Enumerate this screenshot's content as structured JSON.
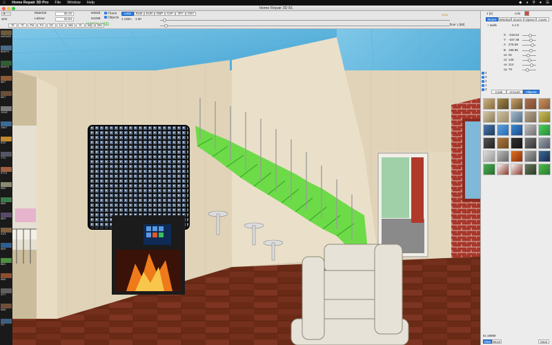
{
  "menubar": {
    "app": "Home Repair 3D Pro",
    "items": [
      "File",
      "Window",
      "Help"
    ]
  },
  "window": {
    "title": "Home Repair 3D 81"
  },
  "toolbar": {
    "project_name": "w03",
    "material_label": "Material",
    "material_value": "36.23",
    "material_total": "84633",
    "labour_label": "Labour",
    "labour_value": "22.94",
    "labour_total": "54298",
    "floors_label": "Floors",
    "objects_label": "Objects",
    "currencies": [
      "USD",
      "RUB",
      "EUR",
      "GBP",
      "CHF",
      "JPY",
      "CNY"
    ],
    "active_currency": "USD",
    "rate_label": "1 USD=",
    "rate_value": "1.00",
    "total": "118831 USD",
    "mode_buttons": [
      "Fl",
      "Tl",
      "Pa",
      "Fv",
      "Gr",
      "La",
      "Ma",
      "G",
      "Wp",
      "Wn"
    ],
    "floor_label": "floor 1 [50]",
    "price_tag": "£112"
  },
  "left_thumbs": [
    {
      "label": "w02/w03",
      "color": "#6a5a3c"
    },
    {
      "label": "504/F5",
      "color": "#4b6a8a"
    },
    {
      "label": "504/F5",
      "color": "#2e5f34"
    },
    {
      "label": "58/7",
      "color": "#8e5a36"
    },
    {
      "label": "58/7",
      "color": "#6b4f3a"
    },
    {
      "label": "141/8",
      "color": "#7a7a7a"
    },
    {
      "label": "156/7",
      "color": "#3a6a95"
    },
    {
      "label": "61/0",
      "color": "#c08a30"
    },
    {
      "label": "77/1",
      "color": "#556"
    },
    {
      "label": "077/1",
      "color": "#a06040"
    },
    {
      "label": "58/0",
      "color": "#8a8a70"
    },
    {
      "label": "58/0",
      "color": "#3b7a4a"
    },
    {
      "label": "58/3",
      "color": "#5a4a6a"
    },
    {
      "label": "41/3",
      "color": "#806040"
    },
    {
      "label": "99/9",
      "color": "#2f5f8f"
    },
    {
      "label": "68/1",
      "color": "#4c8f3f"
    },
    {
      "label": "56/6",
      "color": "#8f4f2f"
    },
    {
      "label": "22/7",
      "color": "#606060"
    },
    {
      "label": "58/8",
      "color": "#704f3a"
    },
    {
      "label": "7/7",
      "color": "#3f5f7f"
    }
  ],
  "right_panel": {
    "counter": "1 [4]",
    "color_label": "colo",
    "tabs_top": [
      "Room",
      "Window",
      "Doors",
      "Opens",
      "Cover"
    ],
    "active_top": "Room",
    "walls_label": "+ walls",
    "walls_value": "4 x 8",
    "props": [
      {
        "name": "X",
        "value": "-216.54",
        "level": 0.55
      },
      {
        "name": "Y",
        "value": "-157.48",
        "level": 0.6
      },
      {
        "name": "A",
        "value": "275.59",
        "level": 0.7
      },
      {
        "name": "B",
        "value": "196.85",
        "level": 0.62
      },
      {
        "name": "ox",
        "value": "61",
        "level": 0.4
      },
      {
        "name": "oz",
        "value": "125",
        "level": 0.5
      },
      {
        "name": "ox",
        "value": "214",
        "level": 0.66
      },
      {
        "name": "oy",
        "value": "70",
        "level": 0.35
      }
    ],
    "levels": [
      "4",
      "3",
      "2",
      "1",
      "0"
    ],
    "tabs_mid": [
      "Code",
      "Amount",
      "Objects"
    ],
    "active_mid": "Objects",
    "objects": [
      {
        "name": "glasses-object-icon",
        "c1": "#c7b58a",
        "c2": "#8a6a3a"
      },
      {
        "name": "chair-object-icon",
        "c1": "#a88a4a",
        "c2": "#5a4a2a"
      },
      {
        "name": "building-object-icon",
        "c1": "#c9a36a",
        "c2": "#6a5030"
      },
      {
        "name": "rug-object-icon",
        "c1": "#b07050",
        "c2": "#7a4a30"
      },
      {
        "name": "sofa-object-icon",
        "c1": "#c8945a",
        "c2": "#8a5a3a"
      },
      {
        "name": "shelf-object-icon",
        "c1": "#d5c9a5",
        "c2": "#8a7a55"
      },
      {
        "name": "pillow-object-icon",
        "c1": "#cfc2a0",
        "c2": "#9a8a6a"
      },
      {
        "name": "cabinet-object-icon",
        "c1": "#a5b9c9",
        "c2": "#50708a"
      },
      {
        "name": "pillow-two-object-icon",
        "c1": "#b8a890",
        "c2": "#7a6a55"
      },
      {
        "name": "lamp-object-icon",
        "c1": "#c9c05a",
        "c2": "#8a7a2a"
      },
      {
        "name": "tv-object-icon",
        "c1": "#4a7ab0",
        "c2": "#203a5a"
      },
      {
        "name": "blue-panel-object-icon",
        "c1": "#5aa0e0",
        "c2": "#2a6ab0"
      },
      {
        "name": "blue-box-object-icon",
        "c1": "#3a8ad0",
        "c2": "#1a4a8a"
      },
      {
        "name": "frame-object-icon",
        "c1": "#c0c0c0",
        "c2": "#707070"
      },
      {
        "name": "green-object-icon",
        "c1": "#4ad05a",
        "c2": "#2a8a3a"
      },
      {
        "name": "cabinet-dark-object-icon",
        "c1": "#555",
        "c2": "#222"
      },
      {
        "name": "wood-object-icon",
        "c1": "#b07a40",
        "c2": "#6a4a20"
      },
      {
        "name": "dark-panel-object-icon",
        "c1": "#333",
        "c2": "#111"
      },
      {
        "name": "dots-object-icon",
        "c1": "#777",
        "c2": "#333"
      },
      {
        "name": "mesh-object-icon",
        "c1": "#9aa",
        "c2": "#556"
      },
      {
        "name": "radiator-object-icon",
        "c1": "#ddd",
        "c2": "#999"
      },
      {
        "name": "shelves-object-icon",
        "c1": "#bbb",
        "c2": "#666"
      },
      {
        "name": "fire-object-icon",
        "c1": "#e07020",
        "c2": "#8a3010"
      },
      {
        "name": "frame-small-object-icon",
        "c1": "#aaa",
        "c2": "#555"
      },
      {
        "name": "photos-object-icon",
        "c1": "#3a6a9a",
        "c2": "#1a2a4a"
      },
      {
        "name": "socket-object-icon",
        "c1": "#4ab050",
        "c2": "#2a6a30"
      },
      {
        "name": "window-object-icon",
        "c1": "#f5f5f5",
        "c2": "#8a3a2a"
      },
      {
        "name": "window-two-object-icon",
        "c1": "#f5f5f5",
        "c2": "#8a3a2a"
      },
      {
        "name": "tree-object-icon",
        "c1": "#6a7a5a",
        "c2": "#2a3a2a"
      },
      {
        "name": "plant-object-icon",
        "c1": "#4ac04a",
        "c2": "#2a7a2a"
      }
    ],
    "footer_count": "6x 19889",
    "footer_buttons": [
      "View",
      "Move"
    ],
    "save_label": "Save"
  }
}
